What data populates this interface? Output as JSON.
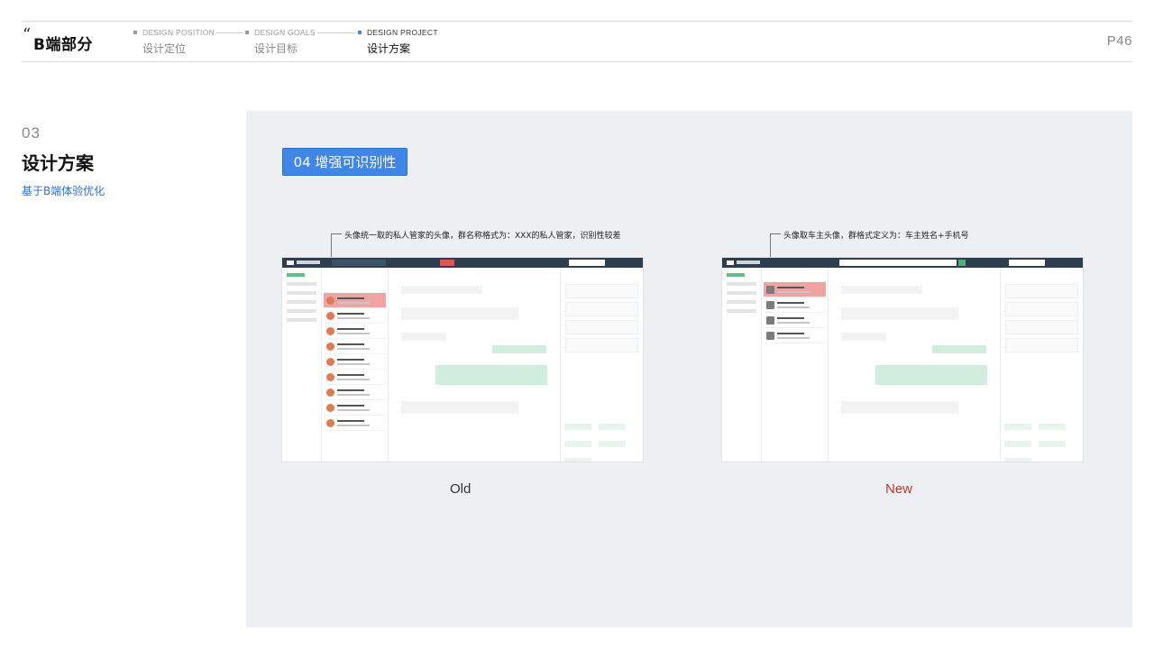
{
  "header": {
    "quote": "“",
    "title": "B端部分",
    "steps": [
      {
        "en": "DESIGN POSITION",
        "cn": "设计定位",
        "active": false
      },
      {
        "en": "DESIGN GOALS",
        "cn": "设计目标",
        "active": false
      },
      {
        "en": "DESIGN PROJECT",
        "cn": "设计方案",
        "active": true
      }
    ],
    "page_number": "P46"
  },
  "section": {
    "number": "03",
    "title": "设计方案",
    "subtitle": "基于B端体验优化"
  },
  "content": {
    "tag": "04 增强可识别性",
    "old": {
      "annotation": "头像统一取的私人管家的头像，群名称格式为：XXX的私人管家，识别性较差",
      "caption": "Old"
    },
    "new": {
      "annotation": "头像取车主头像，群格式定义为：车主姓名+手机号",
      "caption": "New"
    }
  },
  "colors": {
    "accent_blue": "#3f86e6",
    "new_red": "#c0392b",
    "panel_bg": "#eeeff3"
  }
}
